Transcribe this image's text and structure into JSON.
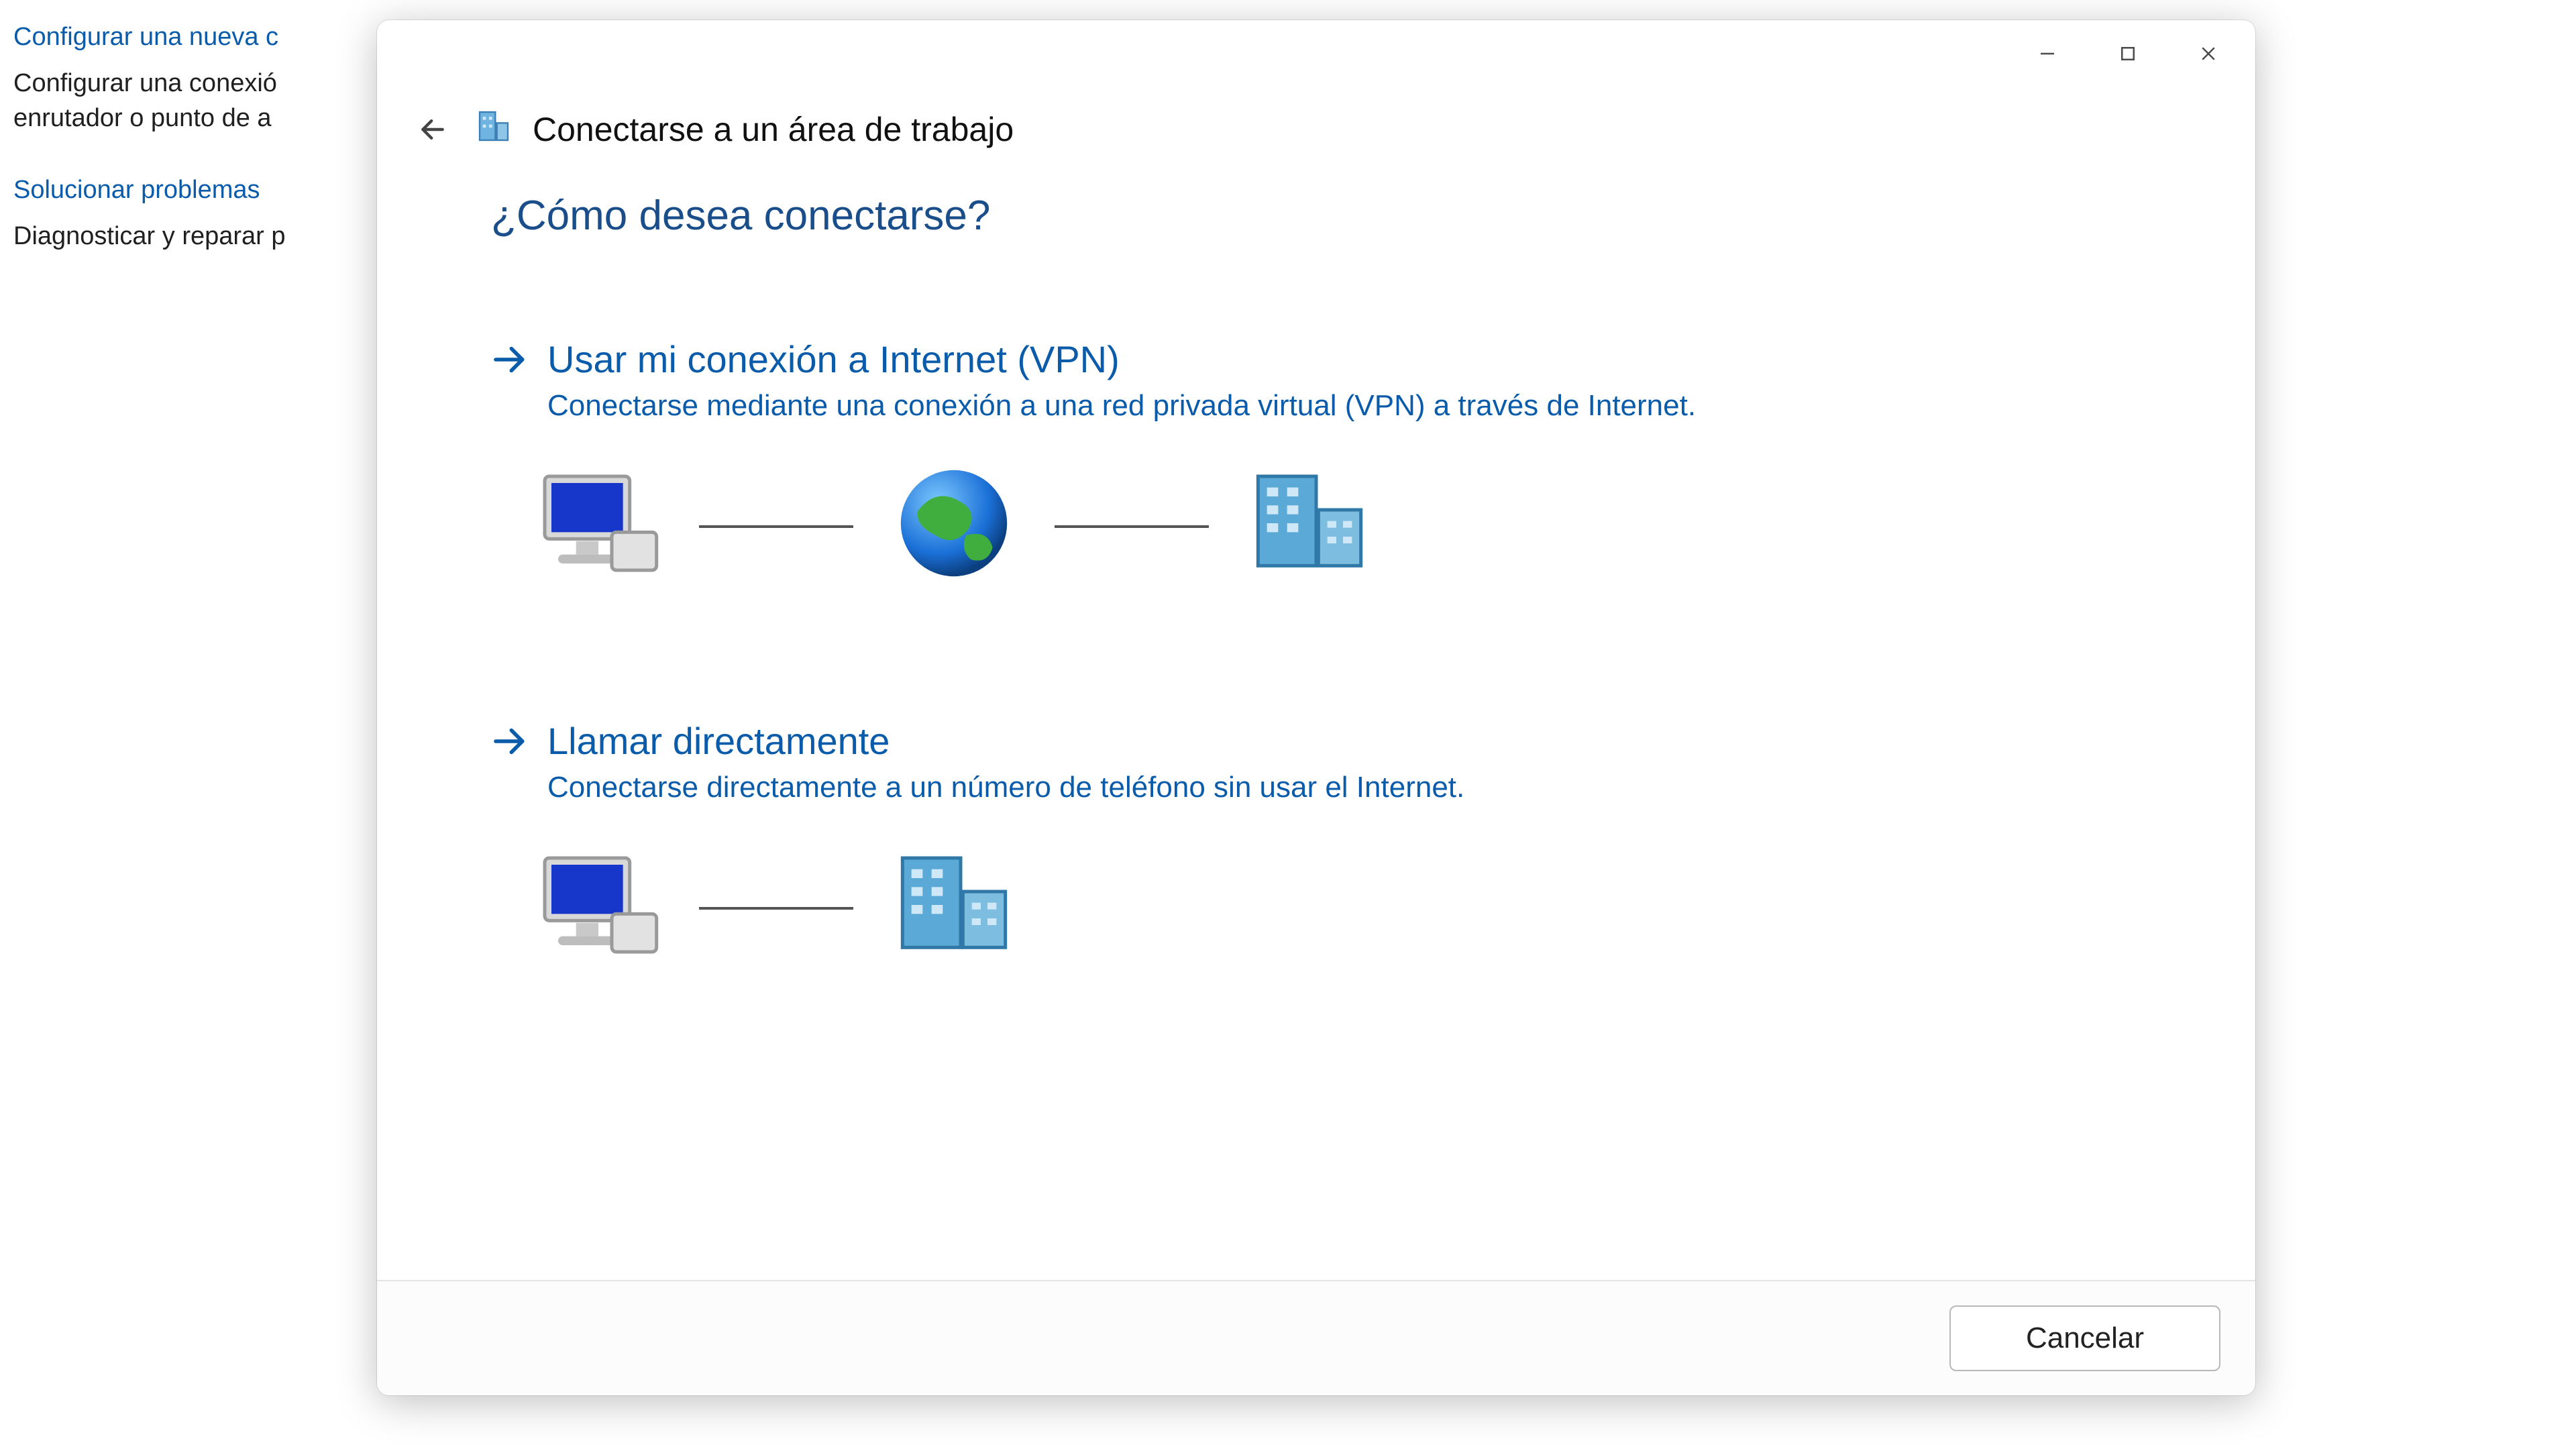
{
  "background": {
    "setup_link": "Configurar una nueva c",
    "setup_desc_line1": "Configurar una conexió",
    "setup_desc_line2": "enrutador o punto de a",
    "troubleshoot_link": "Solucionar problemas",
    "troubleshoot_desc": "Diagnosticar y reparar p"
  },
  "dialog": {
    "title": "Conectarse a un área de trabajo",
    "question": "¿Cómo desea conectarse?",
    "options": {
      "vpn": {
        "title": "Usar mi conexión a Internet (VPN)",
        "desc": "Conectarse mediante una conexión a una red privada virtual (VPN) a través de Internet."
      },
      "dial": {
        "title": "Llamar directamente",
        "desc": "Conectarse directamente a un número de teléfono sin usar el Internet."
      }
    },
    "buttons": {
      "cancel": "Cancelar"
    }
  }
}
